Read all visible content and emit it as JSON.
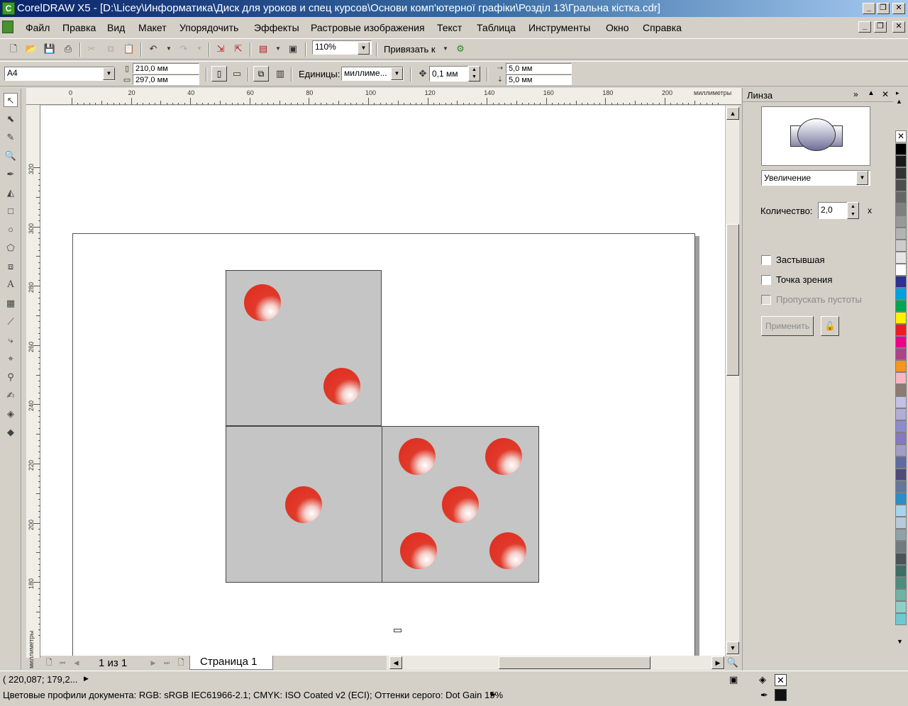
{
  "window": {
    "title": "CorelDRAW X5 - [D:\\Licey\\Информатика\\Диск для уроков и спец курсов\\Основи комп'ютерної графіки\\Розділ 13\\Гральна кістка.cdr]",
    "app_icon_glyph": "C"
  },
  "menu": [
    "Файл",
    "Правка",
    "Вид",
    "Макет",
    "Упорядочить",
    "Эффекты",
    "Растровые изображения",
    "Текст",
    "Таблица",
    "Инструменты",
    "Окно",
    "Справка"
  ],
  "toolbar": {
    "zoom": "110%",
    "snap_label": "Привязать к"
  },
  "property_bar": {
    "paper": "A4",
    "width": "210,0 мм",
    "height": "297,0 мм",
    "units_label": "Единицы:",
    "units_value": "миллиме...",
    "nudge": "0,1 мм",
    "dup_x": "5,0 мм",
    "dup_y": "5,0 мм"
  },
  "ruler": {
    "h_ticks": [
      "0",
      "20",
      "40",
      "60",
      "80",
      "100",
      "120",
      "140",
      "160",
      "180",
      "200"
    ],
    "h_unit": "миллиметры",
    "v_ticks": [
      "320",
      "300",
      "280",
      "260",
      "240",
      "220",
      "200",
      "180"
    ],
    "v_unit": "миллиметры"
  },
  "page_nav": {
    "page_count": "1 из 1",
    "tab": "Страница 1"
  },
  "docker": {
    "title": "Линза",
    "lens_type": "Увеличение",
    "amount_label": "Количество:",
    "amount_value": "2,0",
    "amount_unit": "x",
    "frozen": "Застывшая",
    "viewpoint": "Точка зрения",
    "remove_face": "Пропускать пустоты",
    "apply": "Применить"
  },
  "palette_colors": [
    "#000000",
    "#1a1a1a",
    "#333333",
    "#4d4d4d",
    "#666666",
    "#808080",
    "#999999",
    "#b3b3b3",
    "#cccccc",
    "#e6e6e6",
    "#ffffff",
    "#2e3192",
    "#00a0e3",
    "#00a651",
    "#fff200",
    "#ed1c24",
    "#ec008c",
    "#b0428c",
    "#f7941d",
    "#f9b5c4",
    "#8c7b73",
    "#c4c0e6",
    "#b2acd9",
    "#8e8ccf",
    "#8778c2",
    "#a19ec9",
    "#5f6aa0",
    "#4f4a7a",
    "#63779c",
    "#2a8ec8",
    "#a7d4ec",
    "#b8cad8",
    "#8fa0a8",
    "#707a80",
    "#4a5459",
    "#3f6e66",
    "#4f8c80",
    "#6fb2a6",
    "#8cd0c8",
    "#6cc9d4"
  ],
  "status": {
    "coords": "( 220,087; 179,2...",
    "profiles": "Цветовые профили документа: RGB: sRGB IEC61966-2.1; CMYK: ISO Coated v2 (ECI); Оттенки серого: Dot Gain 15%"
  }
}
